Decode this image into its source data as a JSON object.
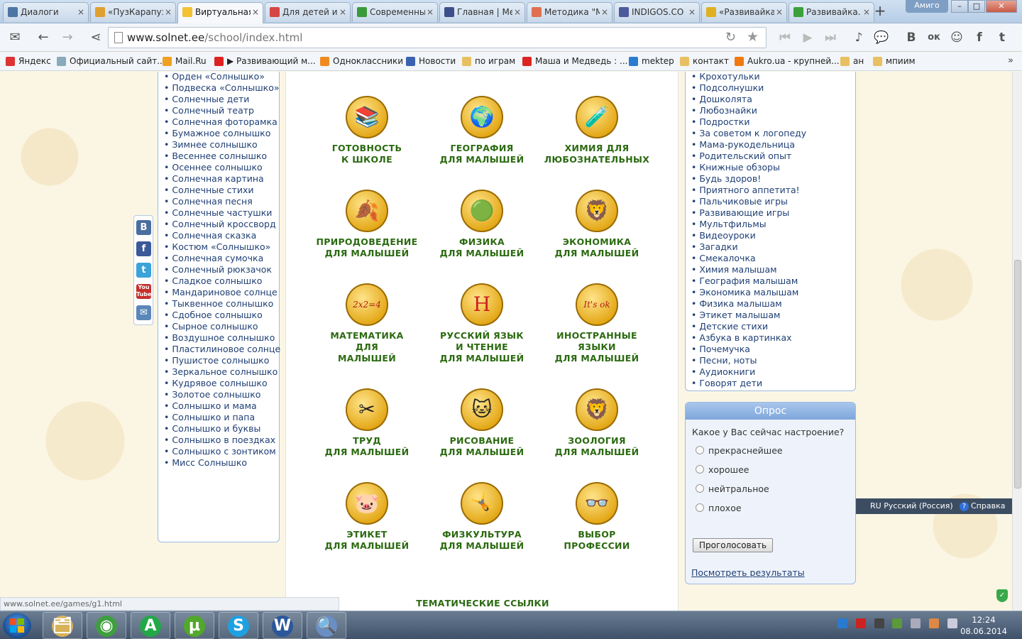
{
  "tabs": [
    {
      "label": "Диалоги",
      "color": "#4c75a3"
    },
    {
      "label": "«ПузКарапуз»",
      "color": "#e0a030"
    },
    {
      "label": "Виртуальная",
      "color": "#f2c230",
      "active": true
    },
    {
      "label": "Для детей и",
      "color": "#d64545"
    },
    {
      "label": "Современны",
      "color": "#3a9a3a"
    },
    {
      "label": "Главная | Ме",
      "color": "#3d4f8a"
    },
    {
      "label": "Методика \"М",
      "color": "#e07050"
    },
    {
      "label": "INDIGOS.CO",
      "color": "#4a5a9a"
    },
    {
      "label": "«Развивайка",
      "color": "#e0b020"
    },
    {
      "label": "Развивайка.",
      "color": "#3ba03b"
    }
  ],
  "tab_close": "×",
  "new_tab": "+",
  "window": {
    "user": "Амиго",
    "minimize": "–",
    "maximize": "□",
    "close": "✕"
  },
  "toolbar": {
    "mail_icon": "✉",
    "back_icon": "←",
    "forward_icon": "→",
    "share_icon": "⋖",
    "url_host": "www.solnet.ee",
    "url_path": "/school/index.html",
    "reload_icon": "↻",
    "star_icon": "★",
    "media": [
      "⏮",
      "▶",
      "⏭"
    ],
    "extensions": [
      "♪",
      "💬",
      "В",
      "ок",
      "☺",
      "f",
      "t"
    ]
  },
  "bookmarks": [
    {
      "label": "Яндекс",
      "color": "#d33"
    },
    {
      "label": "Официальный сайт...",
      "color": "#8ab"
    },
    {
      "label": "Mail.Ru",
      "color": "#f0a020"
    },
    {
      "label": "▶ Развивающий м...",
      "color": "#d22"
    },
    {
      "label": "Одноклассники",
      "color": "#f08a20"
    },
    {
      "label": "Новости",
      "color": "#3a62b0"
    },
    {
      "label": "по играм",
      "color": "#e8c060"
    },
    {
      "label": "Маша и Медведь : ...",
      "color": "#d22"
    },
    {
      "label": "mektep",
      "color": "#2a7ad0"
    },
    {
      "label": "контакт",
      "color": "#e8c060"
    },
    {
      "label": "Aukro.ua - крупней...",
      "color": "#f07a10"
    },
    {
      "label": "ан",
      "color": "#e8c060"
    },
    {
      "label": "мпиим",
      "color": "#e8c060"
    }
  ],
  "bookmarks_more": "»",
  "left_menu": [
    "Орден «Солнышко»",
    "Подвеска «Солнышко»",
    "Солнечные дети",
    "Солнечный театр",
    "Солнечная фоторамка",
    "Бумажное солнышко",
    "Зимнее солнышко",
    "Весеннее солнышко",
    "Осеннее солнышко",
    "Солнечная картина",
    "Солнечные стихи",
    "Солнечная песня",
    "Солнечные частушки",
    "Солнечный кроссворд",
    "Солнечная сказка",
    "Костюм «Солнышко»",
    "Солнечная сумочка",
    "Солнечный рюкзачок",
    "Сладкое солнышко",
    "Мандариновое солнце",
    "Тыквенное солнышко",
    "Сдобное солнышко",
    "Сырное солнышко",
    "Воздушное солнышко",
    "Пластилиновое солнце",
    "Пушистое солнышко",
    "Зеркальное солнышко",
    "Кудрявое солнышко",
    "Золотое солнышко",
    "Солнышко и мама",
    "Солнышко и папа",
    "Солнышко и буквы",
    "Солнышко в поездках",
    "Солнышко с зонтиком",
    "Мисс Солнышко"
  ],
  "share_buttons": [
    {
      "label": "B",
      "color": "#4a6e9e"
    },
    {
      "label": "f",
      "color": "#3b5998"
    },
    {
      "label": "t",
      "color": "#3aa3d8"
    },
    {
      "label": "You Tube",
      "color": "#c4302b"
    },
    {
      "label": "✉",
      "color": "#5b87b8"
    }
  ],
  "subjects": [
    {
      "line1": "ГОТОВНОСТЬ",
      "line2": "К ШКОЛЕ",
      "line3": "",
      "icon": "📚"
    },
    {
      "line1": "ГЕОГРАФИЯ",
      "line2": "ДЛЯ МАЛЫШЕЙ",
      "line3": "",
      "icon": "🌍"
    },
    {
      "line1": "ХИМИЯ ДЛЯ",
      "line2": "ЛЮБОЗНАТЕЛЬНЫХ",
      "line3": "",
      "icon": "🧪"
    },
    {
      "line1": "ПРИРОДОВЕДЕНИЕ",
      "line2": "ДЛЯ МАЛЫШЕЙ",
      "line3": "",
      "icon": "🍂"
    },
    {
      "line1": "ФИЗИКА",
      "line2": "ДЛЯ МАЛЫШЕЙ",
      "line3": "",
      "icon": "🟢"
    },
    {
      "line1": "ЭКОНОМИКА",
      "line2": "ДЛЯ МАЛЫШЕЙ",
      "line3": "",
      "icon": "🦁"
    },
    {
      "line1": "МАТЕМАТИКА",
      "line2": "ДЛЯ",
      "line3": "МАЛЫШЕЙ",
      "icon": "2x2=4"
    },
    {
      "line1": "РУССКИЙ ЯЗЫК",
      "line2": "И ЧТЕНИЕ",
      "line3": "ДЛЯ МАЛЫШЕЙ",
      "icon": "Н"
    },
    {
      "line1": "ИНОСТРАННЫЕ",
      "line2": "ЯЗЫКИ",
      "line3": "ДЛЯ МАЛЫШЕЙ",
      "icon": "It's ok"
    },
    {
      "line1": "ТРУД",
      "line2": "ДЛЯ МАЛЫШЕЙ",
      "line3": "",
      "icon": "✂"
    },
    {
      "line1": "РИСОВАНИЕ",
      "line2": "ДЛЯ МАЛЫШЕЙ",
      "line3": "",
      "icon": "🐱"
    },
    {
      "line1": "ЗООЛОГИЯ",
      "line2": "ДЛЯ МАЛЫШЕЙ",
      "line3": "",
      "icon": "🦁"
    },
    {
      "line1": "ЭТИКЕТ",
      "line2": "ДЛЯ МАЛЫШЕЙ",
      "line3": "",
      "icon": "🐷"
    },
    {
      "line1": "ФИЗКУЛЬТУРА",
      "line2": "ДЛЯ МАЛЫШЕЙ",
      "line3": "",
      "icon": "🤸"
    },
    {
      "line1": "ВЫБОР",
      "line2": "ПРОФЕССИИ",
      "line3": "",
      "icon": "👓"
    }
  ],
  "thematic_links": "ТЕМАТИЧЕСКИЕ ССЫЛКИ",
  "right_menu": [
    "Крохотульки",
    "Подсолнушки",
    "Дошколята",
    "Любознайки",
    "Подростки",
    "За советом к логопеду",
    "Мама-рукодельница",
    "Родительский опыт",
    "Книжные обзоры",
    "Будь здоров!",
    "Приятного аппетита!",
    "Пальчиковые игры",
    "Развивающие игры",
    "Мультфильмы",
    "Видеоуроки",
    "Загадки",
    "Смекалочка",
    "Химия малышам",
    "География малышам",
    "Экономика малышам",
    "Физика малышам",
    "Этикет малышам",
    "Детские стихи",
    "Азбука в картинках",
    "Почемучка",
    "Песни, ноты",
    "Аудиокниги",
    "Говорят дети"
  ],
  "poll": {
    "title": "Опрос",
    "question": "Какое у Вас сейчас настроение?",
    "options": [
      "прекраснейшее",
      "хорошее",
      "нейтральное",
      "плохое"
    ],
    "vote_button": "Проголосовать",
    "results_link": "Посмотреть результаты"
  },
  "language_bar": {
    "lang": "RU Русский (Россия)",
    "help": "Справка"
  },
  "status_url": "www.solnet.ee/games/g1.html",
  "taskbar": {
    "apps": [
      {
        "icon": "🗂",
        "color": "#d8b25a"
      },
      {
        "icon": "◉",
        "color": "#3f9e3f"
      },
      {
        "icon": "A",
        "color": "#23a847"
      },
      {
        "icon": "µ",
        "color": "#52a82a"
      },
      {
        "icon": "S",
        "color": "#1ea1e0"
      },
      {
        "icon": "W",
        "color": "#2b579a"
      },
      {
        "icon": "🔍",
        "color": "#6a8fc4"
      }
    ],
    "time": "12:24",
    "date": "08.06.2014"
  }
}
